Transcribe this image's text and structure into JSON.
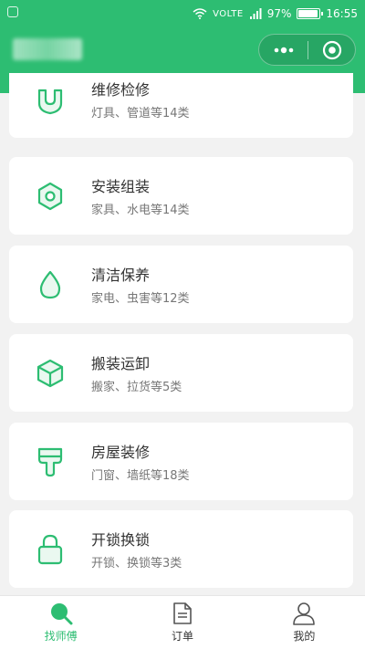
{
  "status_bar": {
    "volte": "VOLTE",
    "battery": "97%",
    "time": "16:55"
  },
  "capsule": {
    "more_icon": "more-dots-icon",
    "close_icon": "target-circle-icon"
  },
  "accent_color": "#2dbd72",
  "categories": [
    {
      "title": "维修检修",
      "sub": "灯具、管道等14类",
      "icon": "u-shield-icon"
    },
    {
      "title": "安装组装",
      "sub": "家具、水电等14类",
      "icon": "hex-nut-icon"
    },
    {
      "title": "清洁保养",
      "sub": "家电、虫害等12类",
      "icon": "water-drop-icon"
    },
    {
      "title": "搬装运卸",
      "sub": "搬家、拉货等5类",
      "icon": "box-icon"
    },
    {
      "title": "房屋装修",
      "sub": "门窗、墙纸等18类",
      "icon": "paint-brush-icon"
    },
    {
      "title": "开锁换锁",
      "sub": "开锁、换锁等3类",
      "icon": "lock-icon"
    }
  ],
  "tabbar": {
    "tabs": [
      {
        "label": "找师傅",
        "icon": "search-icon",
        "active": true
      },
      {
        "label": "订单",
        "icon": "document-icon",
        "active": false
      },
      {
        "label": "我的",
        "icon": "user-icon",
        "active": false
      }
    ]
  }
}
